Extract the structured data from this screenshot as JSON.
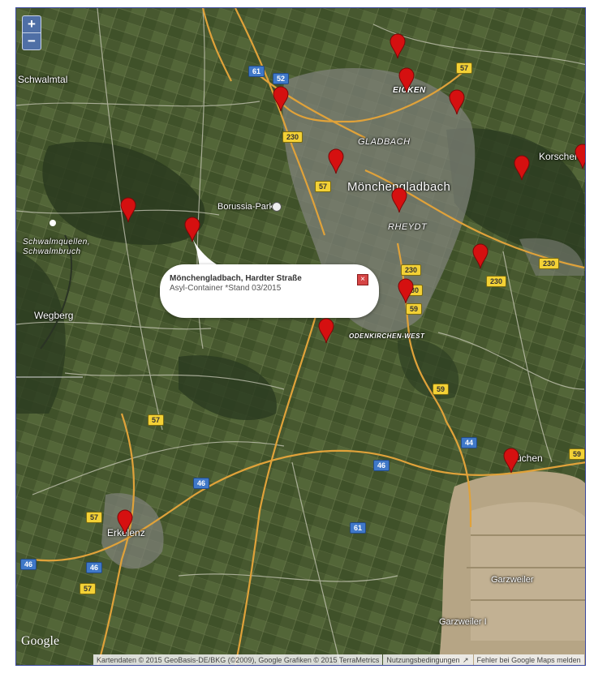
{
  "zoom": {
    "in_label": "+",
    "out_label": "−"
  },
  "places": {
    "schwalmtal": "Schwalmtal",
    "eicken": "EICKEN",
    "gladbach": "GLADBACH",
    "moenchengladbach": "Mönchengladbach",
    "korschenbroich": "Korschenbroic",
    "borussia_park": "Borussia-Park",
    "rheydt": "RHEYDT",
    "schwalmquellen": "Schwalmquellen,",
    "schwalmbruch": "Schwalmbruch",
    "wegberg": "Wegberg",
    "odenkirchen": "ODENKIRCHEN-WEST",
    "juchen": "üchen",
    "erkelenz": "Erkelenz",
    "garzweiler": "Garzweiler",
    "garzweiler_i": "Garzweiler I"
  },
  "shields": {
    "a61_top": "61",
    "a52": "52",
    "a57_top": "57",
    "b230_a": "230",
    "b230_b": "230",
    "b57_mid": "57",
    "a230_c": "230",
    "b230_right": "230",
    "b230_d": "230",
    "b59_a": "59",
    "b59_b": "59",
    "a44": "44",
    "a46_mid": "46",
    "a46_left": "46",
    "a46_b": "46",
    "a61_low": "61",
    "b57_low": "57",
    "b57_left": "57",
    "b57_bottom": "57",
    "a46_west": "46",
    "b59_right": "59"
  },
  "popup": {
    "title": "Mönchengladbach, Hardter Straße",
    "description": "Asyl-Container *Stand 03/2015"
  },
  "branding": {
    "google": "Google"
  },
  "footer": {
    "attribution": "Kartendaten © 2015 GeoBasis-DE/BKG (©2009), Google Grafiken © 2015 TerraMetrics",
    "terms": "Nutzungsbedingungen",
    "report": "Fehler bei Google Maps melden"
  },
  "colors": {
    "marker": "#d51010",
    "autobahn": "#e0a23a",
    "frame": "#3b49a0"
  }
}
